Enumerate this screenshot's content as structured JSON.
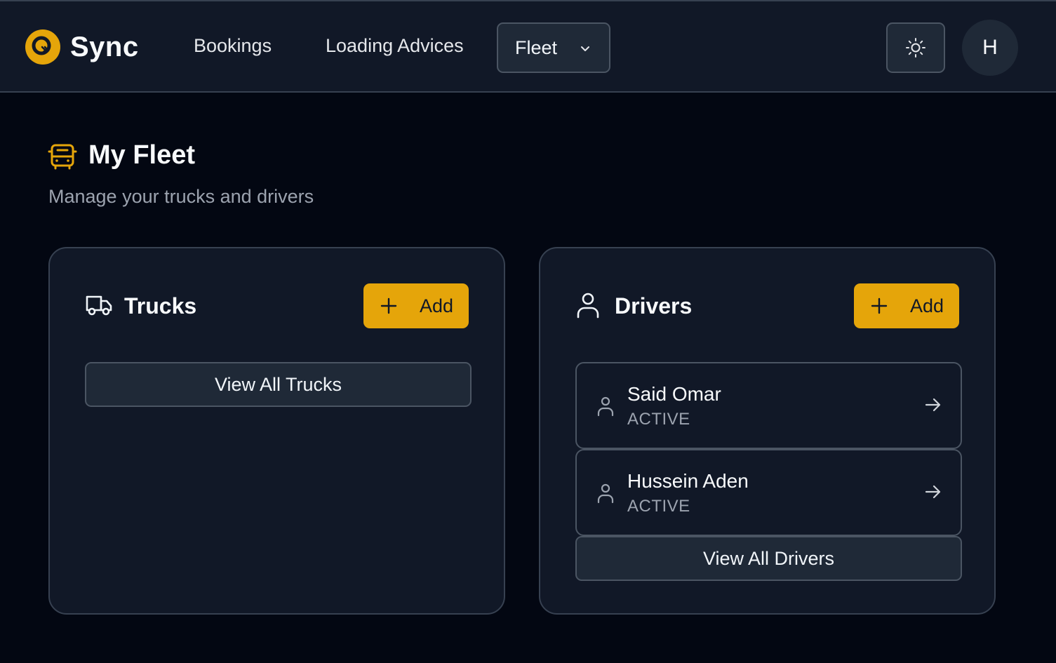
{
  "nav": {
    "brand": "Sync",
    "links": [
      "Bookings",
      "Loading Advices"
    ],
    "fleet_dropdown": "Fleet",
    "avatar_initial": "H"
  },
  "page": {
    "title": "My Fleet",
    "subtitle": "Manage your trucks and drivers"
  },
  "trucks": {
    "title": "Trucks",
    "add_label": "Add",
    "view_all_label": "View All Trucks"
  },
  "drivers": {
    "title": "Drivers",
    "add_label": "Add",
    "items": [
      {
        "name": "Said Omar",
        "status": "ACTIVE"
      },
      {
        "name": "Hussein Aden",
        "status": "ACTIVE"
      }
    ],
    "view_all_label": "View All Drivers"
  },
  "colors": {
    "accent": "#e5a50a",
    "background": "#030712",
    "surface": "#111827",
    "muted_text": "#9ca3af"
  },
  "icons": {
    "logo": "sync-logo-icon",
    "fleet": "chevron-down-icon",
    "theme": "sun-icon",
    "page": "bus-icon",
    "trucks": "truck-icon",
    "drivers": "user-icon",
    "add": "plus-icon",
    "driver_row": "user-icon",
    "driver_row_action": "arrow-right-icon"
  }
}
